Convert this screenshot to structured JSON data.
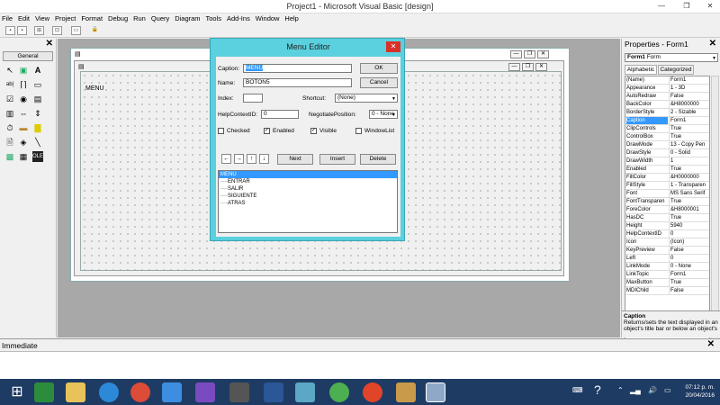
{
  "window": {
    "title": "Project1 - Microsoft Visual Basic [design]",
    "minimize": "—",
    "maximize": "❐",
    "close": "✕"
  },
  "menu": [
    "File",
    "Edit",
    "View",
    "Project",
    "Format",
    "Debug",
    "Run",
    "Query",
    "Diagram",
    "Tools",
    "Add-Ins",
    "Window",
    "Help"
  ],
  "toolbox": {
    "tab": "General",
    "close": "✕"
  },
  "form": {
    "caption_text": "MENU"
  },
  "menu_editor": {
    "title": "Menu Editor",
    "close": "✕",
    "caption_label": "Caption:",
    "caption_value": "MENU",
    "name_label": "Name:",
    "name_value": "BOTON5",
    "index_label": "Index:",
    "index_value": "",
    "shortcut_label": "Shortcut:",
    "shortcut_value": "(None)",
    "helpcontext_label": "HelpContextID:",
    "helpcontext_value": "0",
    "negotiate_label": "NegotiatePosition:",
    "negotiate_value": "0 - None",
    "checked_label": "Checked",
    "enabled_label": "Enabled",
    "visible_label": "Visible",
    "windowlist_label": "WindowList",
    "ok_label": "OK",
    "cancel_label": "Cancel",
    "next_label": "Next",
    "insert_label": "Insert",
    "delete_label": "Delete",
    "arrows": [
      "←",
      "→",
      "↑",
      "↓"
    ],
    "items": [
      "MENU",
      "····ENTRAR",
      "····SALIR",
      "····SIGUIENTE",
      "····ATRAS"
    ]
  },
  "properties": {
    "title": "Properties - Form1",
    "close": "✕",
    "object_name": "Form1",
    "object_type": "Form",
    "tab_alphabetic": "Alphabetic",
    "tab_categorized": "Categorized",
    "rows": [
      [
        "(Name)",
        "Form1"
      ],
      [
        "Appearance",
        "1 - 3D"
      ],
      [
        "AutoRedraw",
        "False"
      ],
      [
        "BackColor",
        "&H8000000"
      ],
      [
        "BorderStyle",
        "2 - Sizable"
      ],
      [
        "Caption",
        "Form1"
      ],
      [
        "ClipControls",
        "True"
      ],
      [
        "ControlBox",
        "True"
      ],
      [
        "DrawMode",
        "13 - Copy Pen"
      ],
      [
        "DrawStyle",
        "0 - Solid"
      ],
      [
        "DrawWidth",
        "1"
      ],
      [
        "Enabled",
        "True"
      ],
      [
        "FillColor",
        "&H0000000"
      ],
      [
        "FillStyle",
        "1 - Transparen"
      ],
      [
        "Font",
        "MS Sans Serif"
      ],
      [
        "FontTransparen",
        "True"
      ],
      [
        "ForeColor",
        "&H8000001"
      ],
      [
        "HasDC",
        "True"
      ],
      [
        "Height",
        "5940"
      ],
      [
        "HelpContextID",
        "0"
      ],
      [
        "Icon",
        "(Icon)"
      ],
      [
        "KeyPreview",
        "False"
      ],
      [
        "Left",
        "0"
      ],
      [
        "LinkMode",
        "0 - None"
      ],
      [
        "LinkTopic",
        "Form1"
      ],
      [
        "MaxButton",
        "True"
      ],
      [
        "MDIChild",
        "False"
      ]
    ],
    "desc_title": "Caption",
    "desc_text": "Returns/sets the text displayed in an object's title bar or below an object's"
  },
  "immediate": {
    "title": "Immediate",
    "close": "✕"
  },
  "clock": {
    "time": "07:12 p. m.",
    "date": "20/04/2016"
  }
}
